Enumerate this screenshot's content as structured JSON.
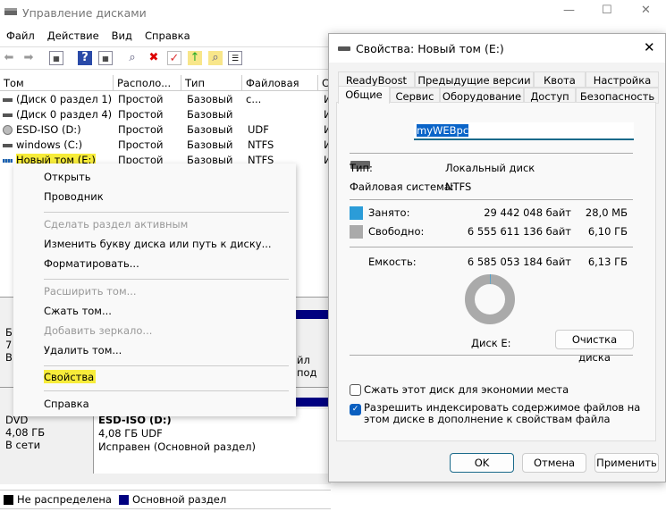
{
  "window": {
    "title": "Управление дисками",
    "minimize": "—",
    "maximize": "☐",
    "close": "✕"
  },
  "menu": [
    "Файл",
    "Действие",
    "Вид",
    "Справка"
  ],
  "toolbar_icons": [
    "back-icon",
    "forward-icon",
    "console-tree-icon",
    "help-icon",
    "action-pane-icon",
    "connect-drive-icon",
    "delete-icon",
    "check-icon",
    "folder-up-icon",
    "folder-search-icon",
    "properties-icon"
  ],
  "table": {
    "headers": [
      "Том",
      "Располо...",
      "Тип",
      "Файловая с...",
      "С"
    ],
    "rows": [
      {
        "name": "(Диск 0 раздел 1)",
        "layout": "Простой",
        "type": "Базовый",
        "fs": "",
        "s": "И"
      },
      {
        "name": "(Диск 0 раздел 4)",
        "layout": "Простой",
        "type": "Базовый",
        "fs": "",
        "s": "И"
      },
      {
        "name": "ESD-ISO (D:)",
        "layout": "Простой",
        "type": "Базовый",
        "fs": "UDF",
        "s": "И"
      },
      {
        "name": "windows (C:)",
        "layout": "Простой",
        "type": "Базовый",
        "fs": "NTFS",
        "s": "И"
      },
      {
        "name": "Новый том (E:)",
        "layout": "Простой",
        "type": "Базовый",
        "fs": "NTFS",
        "s": "И"
      }
    ]
  },
  "context_menu": {
    "items": [
      {
        "label": "Открыть",
        "enabled": true
      },
      {
        "label": "Проводник",
        "enabled": true
      },
      {
        "label": "Сделать раздел активным",
        "enabled": false
      },
      {
        "label": "Изменить букву диска или путь к диску...",
        "enabled": true
      },
      {
        "label": "Форматировать...",
        "enabled": true
      },
      {
        "label": "Расширить том...",
        "enabled": false
      },
      {
        "label": "Сжать том...",
        "enabled": true
      },
      {
        "label": "Добавить зеркало...",
        "enabled": false
      },
      {
        "label": "Удалить том...",
        "enabled": true
      },
      {
        "label": "Свойства",
        "enabled": true
      },
      {
        "label": "Справка",
        "enabled": true
      }
    ]
  },
  "lower": {
    "disk0_partial": [
      "Б",
      "7",
      "В"
    ],
    "partial_text": "йл под",
    "cdrom": {
      "type": "DVD",
      "size": "4,08 ГБ",
      "status": "В сети"
    },
    "volume": {
      "name": "ESD-ISO  (D:)",
      "size": "4,08 ГБ UDF",
      "status": "Исправен (Основной раздел)"
    }
  },
  "legend": [
    {
      "label": "Не распределена",
      "color": "#000000"
    },
    {
      "label": "Основной раздел",
      "color": "#000080"
    }
  ],
  "dialog": {
    "title": "Свойства: Новый том (E:)",
    "close": "✕",
    "tabs_row1": [
      "ReadyBoost",
      "Предыдущие версии",
      "Квота",
      "Настройка"
    ],
    "tabs_row2": [
      "Общие",
      "Сервис",
      "Оборудование",
      "Доступ",
      "Безопасность"
    ],
    "active_tab": "Общие",
    "volume_label": "myWEBpc",
    "type_label": "Тип:",
    "type_value": "Локальный диск",
    "fs_label": "Файловая система:",
    "fs_value": "NTFS",
    "used_label": "Занято:",
    "used_bytes": "29 442 048 байт",
    "used_size": "28,0 МБ",
    "used_color": "#2b9cd8",
    "free_label": "Свободно:",
    "free_bytes": "6 555 611 136 байт",
    "free_size": "6,10 ГБ",
    "free_color": "#aaaaaa",
    "capacity_label": "Емкость:",
    "capacity_bytes": "6 585 053 184 байт",
    "capacity_size": "6,13 ГБ",
    "used_fraction": 0.0045,
    "disk_label": "Диск E:",
    "cleanup": "Очистка диска",
    "compress_label": "Сжать этот диск для экономии места",
    "compress_checked": false,
    "index_label": "Разрешить индексировать содержимое файлов на этом диске в дополнение к свойствам файла",
    "index_checked": true,
    "ok": "OK",
    "cancel": "Отмена",
    "apply": "Применить"
  }
}
